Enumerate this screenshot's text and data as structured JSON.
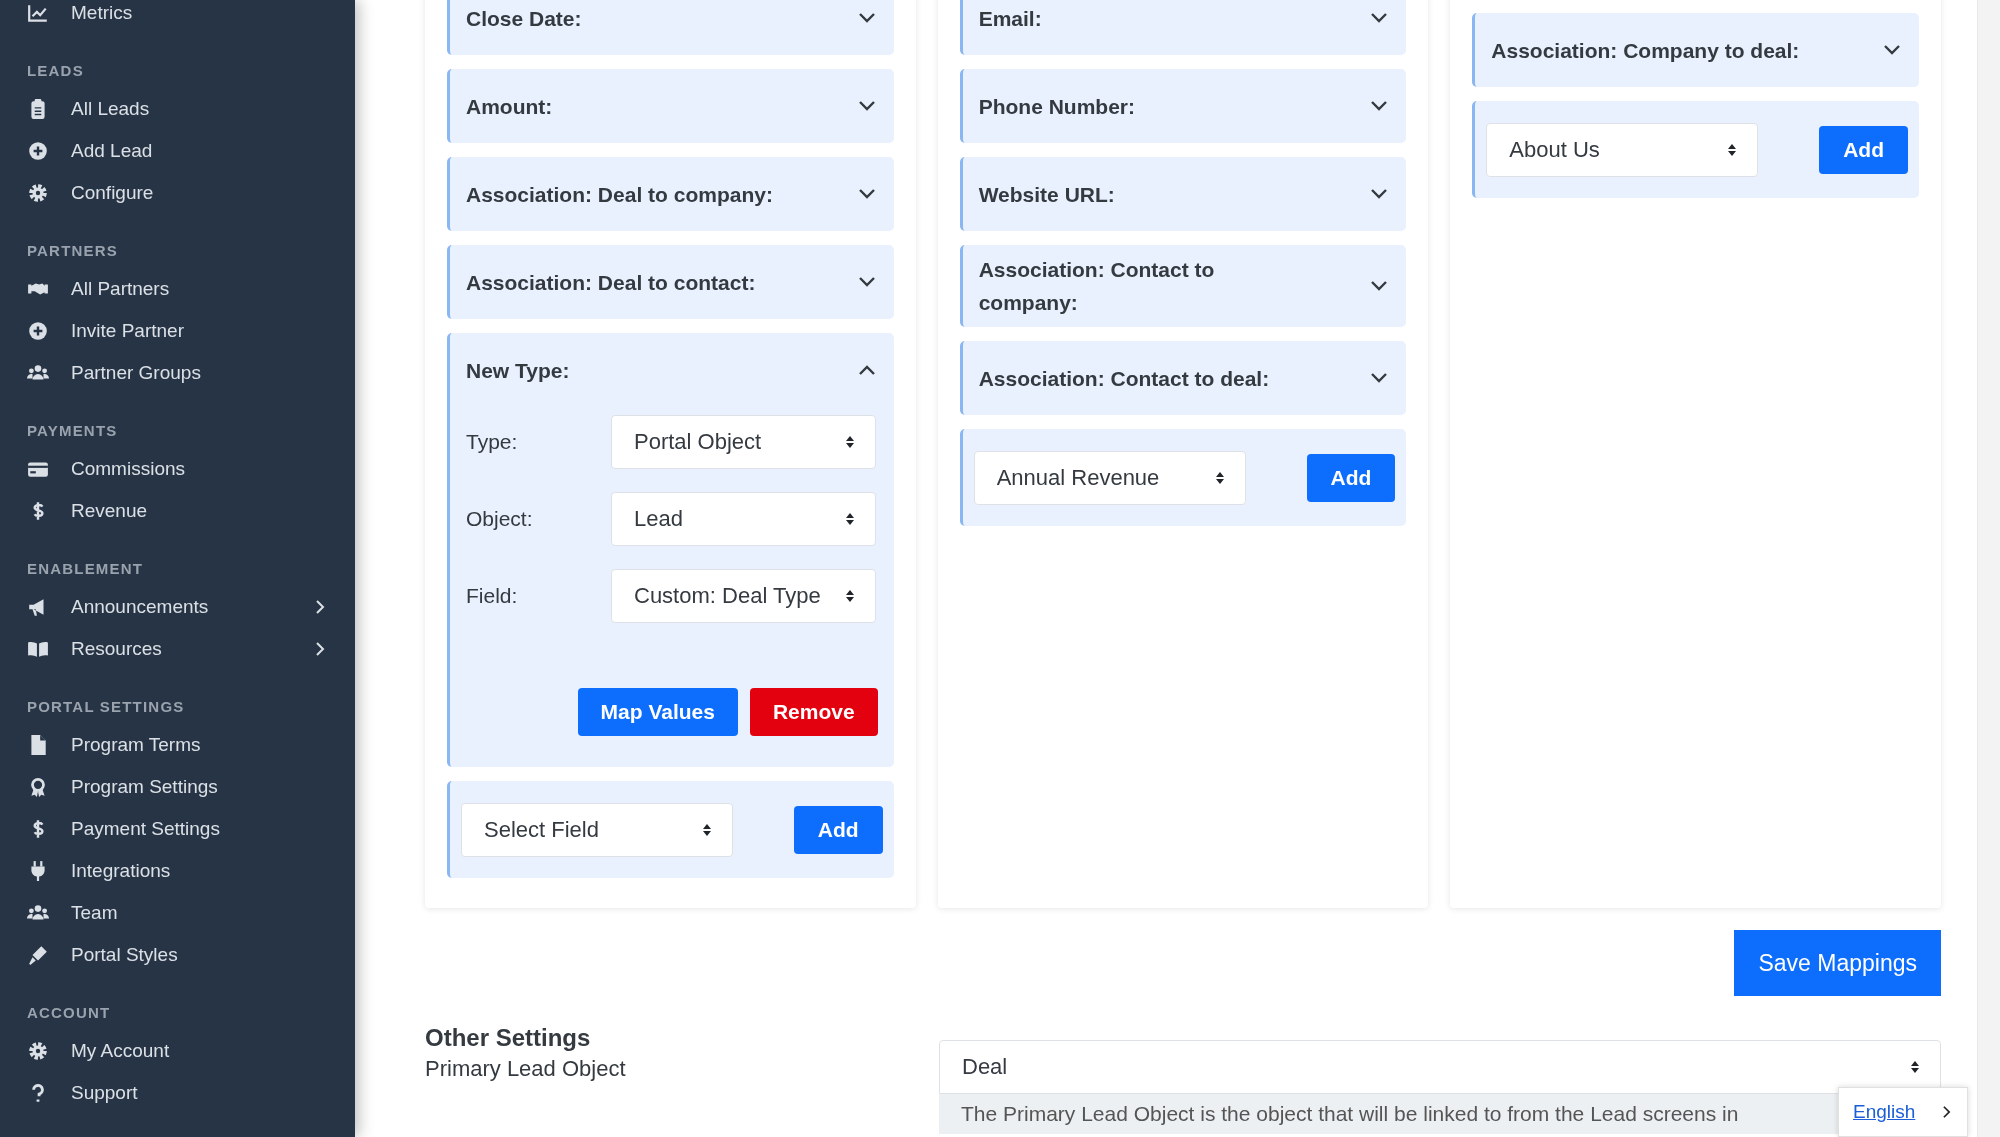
{
  "sidebar": {
    "sections": [
      {
        "items": [
          {
            "label": "Metrics",
            "submenu": false
          }
        ]
      },
      {
        "heading": "LEADS",
        "items": [
          {
            "label": "All Leads",
            "submenu": false
          },
          {
            "label": "Add Lead",
            "submenu": false
          },
          {
            "label": "Configure",
            "submenu": false
          }
        ]
      },
      {
        "heading": "PARTNERS",
        "items": [
          {
            "label": "All Partners",
            "submenu": false
          },
          {
            "label": "Invite Partner",
            "submenu": false
          },
          {
            "label": "Partner Groups",
            "submenu": false
          }
        ]
      },
      {
        "heading": "PAYMENTS",
        "items": [
          {
            "label": "Commissions",
            "submenu": false
          },
          {
            "label": "Revenue",
            "submenu": false
          }
        ]
      },
      {
        "heading": "ENABLEMENT",
        "items": [
          {
            "label": "Announcements",
            "submenu": true
          },
          {
            "label": "Resources",
            "submenu": true
          }
        ]
      },
      {
        "heading": "PORTAL SETTINGS",
        "items": [
          {
            "label": "Program Terms",
            "submenu": false
          },
          {
            "label": "Program Settings",
            "submenu": false
          },
          {
            "label": "Payment Settings",
            "submenu": false
          },
          {
            "label": "Integrations",
            "submenu": false
          },
          {
            "label": "Team",
            "submenu": false
          },
          {
            "label": "Portal Styles",
            "submenu": false
          }
        ]
      },
      {
        "heading": "ACCOUNT",
        "items": [
          {
            "label": "My Account",
            "submenu": false
          },
          {
            "label": "Support",
            "submenu": false
          }
        ]
      }
    ]
  },
  "mapping_columns": [
    {
      "fields": [
        {
          "label": "Close Date:",
          "expanded": false
        },
        {
          "label": "Amount:",
          "expanded": false
        },
        {
          "label": "Association: Deal to company:",
          "expanded": false
        },
        {
          "label": "Association: Deal to contact:",
          "expanded": false
        },
        {
          "label": "New Type:",
          "expanded": true,
          "settings": [
            {
              "label": "Type:",
              "value": "Portal Object"
            },
            {
              "label": "Object:",
              "value": "Lead"
            },
            {
              "label": "Field:",
              "value": "Custom: Deal Type"
            }
          ],
          "buttons": [
            {
              "label": "Map Values",
              "kind": "primary"
            },
            {
              "label": "Remove",
              "kind": "danger"
            }
          ]
        }
      ],
      "add_row": {
        "select": "Select Field",
        "button": "Add"
      }
    },
    {
      "fields": [
        {
          "label": "Email:",
          "expanded": false
        },
        {
          "label": "Phone Number:",
          "expanded": false
        },
        {
          "label": "Website URL:",
          "expanded": false
        },
        {
          "label": "Association: Contact to company:",
          "expanded": false
        },
        {
          "label": "Association: Contact to deal:",
          "expanded": false
        }
      ],
      "add_row": {
        "select": "Annual Revenue",
        "button": "Add"
      }
    },
    {
      "fields": [
        {
          "label": "Association: Company to deal:",
          "expanded": false
        }
      ],
      "add_row": {
        "select": "About Us",
        "button": "Add"
      }
    }
  ],
  "save_button": "Save Mappings",
  "other_settings": {
    "title": "Other Settings",
    "label": "Primary Lead Object",
    "select": "Deal",
    "hint": "The Primary Lead Object is the object that will be linked to from the Lead screens in"
  },
  "language": {
    "label": "English"
  }
}
